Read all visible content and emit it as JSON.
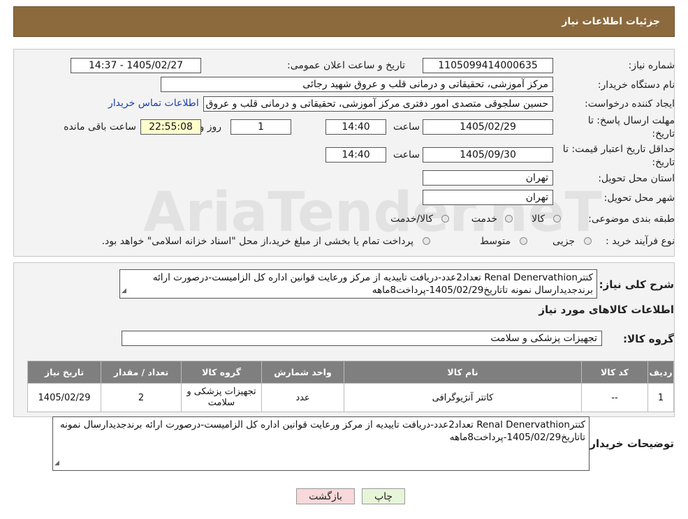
{
  "header": {
    "title": "جزئیات اطلاعات نیاز"
  },
  "form": {
    "need_number_label": "شماره نیاز:",
    "need_number": "1105099414000635",
    "announce_label": "تاریخ و ساعت اعلان عمومی:",
    "announce_value": "1405/02/27 - 14:37",
    "buyer_org_label": "نام دستگاه خریدار:",
    "buyer_org": "مرکز آموزشی، تحقیقاتی و درمانی قلب و عروق شهید رجائی",
    "creator_label": "ایجاد کننده درخواست:",
    "creator": "حسین سلجوقی متصدی امور دفتری مرکز آموزشی، تحقیقاتی و درمانی قلب و عروق شهید رجائی",
    "contact_link": "اطلاعات تماس خریدار",
    "deadline_label_1": "مهلت ارسال پاسخ: تا",
    "deadline_label_2": "تاریخ:",
    "deadline_date": "1405/02/29",
    "time_label": "ساعت",
    "deadline_time": "14:40",
    "days_value": "1",
    "days_label": "روز و",
    "remaining_time": "22:55:08",
    "remaining_label": "ساعت باقی مانده",
    "validity_label_1": "حداقل تاریخ اعتبار قیمت: تا",
    "validity_label_2": "تاریخ:",
    "validity_date": "1405/09/30",
    "validity_time": "14:40",
    "province_label": "استان محل تحویل:",
    "province": "تهران",
    "city_label": "شهر محل تحویل:",
    "city": "تهران",
    "category_label": "طبقه بندی موضوعی:",
    "category_options": [
      "کالا",
      "خدمت",
      "کالا/خدمت"
    ],
    "process_label": "نوع فرآیند خرید :",
    "process_options": [
      "جزیی",
      "متوسط"
    ],
    "process_note": "پرداخت تمام یا بخشی از مبلغ خرید،از محل \"اسناد خزانه اسلامی\" خواهد بود."
  },
  "summary": {
    "label": "شرح کلی نیاز:",
    "text": "کتترRenal Denervathion تعداد2عدد-دریافت تاییدیه از مرکز ورعایت قوانین اداره کل الزامیست-درصورت ارائه برندجدیدارسال نمونه تاتاریخ1405/02/29-پرداخت8ماهه"
  },
  "goods": {
    "section_title": "اطلاعات کالاهای مورد نیاز",
    "group_label": "گروه کالا:",
    "group_value": "تجهیزات پزشکی و سلامت",
    "columns": [
      "ردیف",
      "کد کالا",
      "نام کالا",
      "واحد شمارش",
      "گروه کالا",
      "تعداد / مقدار",
      "تاریخ نیاز"
    ],
    "rows": [
      [
        "1",
        "--",
        "کاتتر آنژیوگرافی",
        "عدد",
        "تجهیزات پزشکی و سلامت",
        "2",
        "1405/02/29"
      ]
    ]
  },
  "buyer_notes": {
    "label": "توضیحات خریدار:",
    "text": "کتترRenal Denervathion تعداد2عدد-دریافت تاییدیه از مرکز ورعایت قوانین اداره کل الزامیست-درصورت ارائه برندجدیدارسال نمونه تاتاریخ1405/02/29-پرداخت8ماهه"
  },
  "buttons": {
    "print": "چاپ",
    "back": "بازگشت"
  },
  "colors": {
    "header_bg": "#8c6a3d",
    "table_header": "#7f7f7f",
    "link": "#1a3fb0",
    "back_btn": "#f8d8d8",
    "print_btn": "#e6f5d8"
  },
  "watermark": "AriaTender.neT"
}
